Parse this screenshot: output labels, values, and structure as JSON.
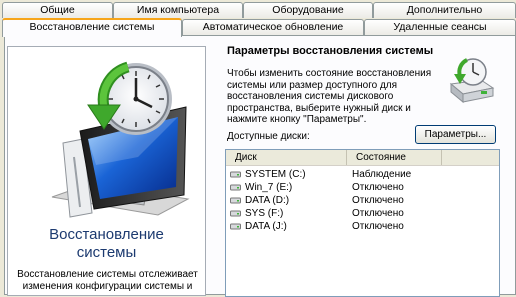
{
  "tabs_row1": [
    "Общие",
    "Имя компьютера",
    "Оборудование",
    "Дополнительно"
  ],
  "tabs_row2": [
    "Восстановление системы",
    "Автоматическое обновление",
    "Удаленные сеансы"
  ],
  "left": {
    "title_line1": "Восстановление",
    "title_line2": "системы",
    "desc_line1": "Восстановление системы отслеживает",
    "desc_line2": "изменения конфигурации системы и"
  },
  "right": {
    "section_title": "Параметры восстановления системы",
    "desc": "Чтобы изменить состояние восстановления системы или размер доступного для восстановления системы дискового пространства, выберите нужный диск и нажмите кнопку \"Параметры\".",
    "available_label": "Доступные диски:",
    "params_button": "Параметры...",
    "columns": {
      "disk": "Диск",
      "state": "Состояние"
    },
    "drives": [
      {
        "name": "SYSTEM (C:)",
        "state": "Наблюдение"
      },
      {
        "name": "Win_7 (E:)",
        "state": "Отключено"
      },
      {
        "name": "DATA (D:)",
        "state": "Отключено"
      },
      {
        "name": "SYS (F:)",
        "state": "Отключено"
      },
      {
        "name": "DATA (J:)",
        "state": "Отключено"
      }
    ]
  },
  "colors": {
    "accent_tab": "#f7a519",
    "title_blue": "#1c3a70",
    "arrow_green": "#3fa82c"
  },
  "icons": [
    "restore-monitor-icon",
    "restore-drive-icon",
    "disk-drive-icon"
  ]
}
